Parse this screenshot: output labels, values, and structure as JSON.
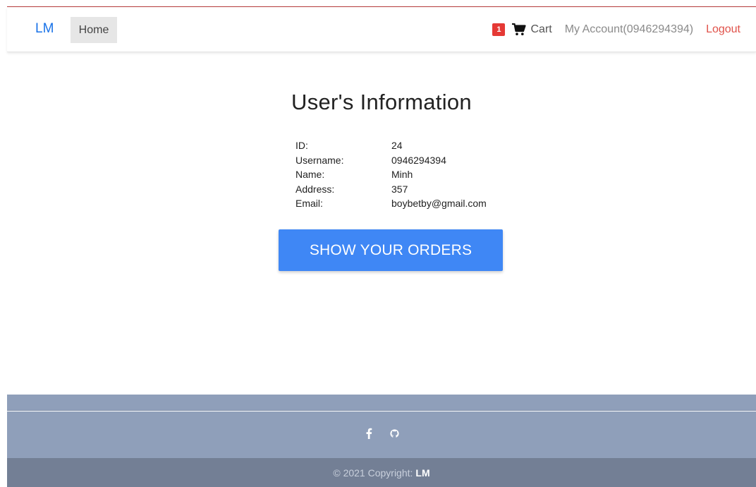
{
  "navbar": {
    "brand": "LM",
    "home_label": "Home",
    "cart_badge": "1",
    "cart_label": "Cart",
    "account_label": "My Account(0946294394)",
    "logout_label": "Logout",
    "logout_color": "#e0524a",
    "brand_color": "#1a73e8"
  },
  "main": {
    "title": "User's Information",
    "fields": [
      {
        "label": "ID:",
        "value": "24"
      },
      {
        "label": "Username:",
        "value": "0946294394"
      },
      {
        "label": "Name:",
        "value": "Minh"
      },
      {
        "label": "Address:",
        "value": "357"
      },
      {
        "label": "Email:",
        "value": "boybetby@gmail.com"
      }
    ],
    "orders_button": "SHOW YOUR ORDERS",
    "button_color": "#3f87f5"
  },
  "footer": {
    "social_icons": [
      "facebook-icon",
      "github-icon"
    ],
    "copyright_text": "© 2021 Copyright:",
    "copyright_brand": "LM",
    "footer_color": "#8f9fba",
    "footer_bottom_color": "#737f95"
  }
}
